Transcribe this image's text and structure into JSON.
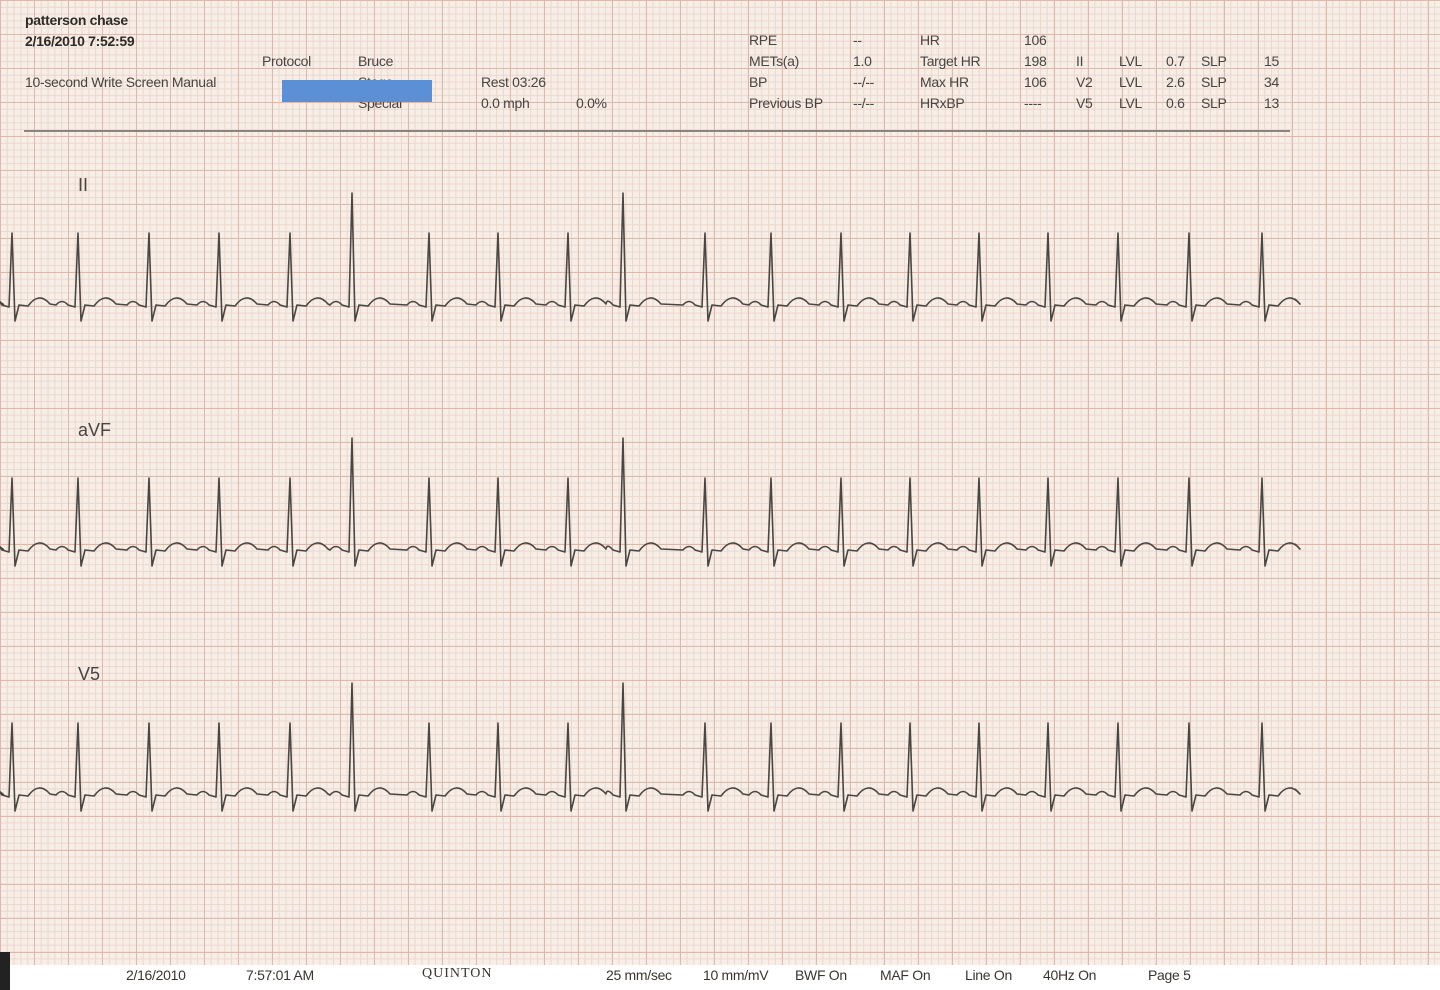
{
  "header": {
    "patient": "patterson chase",
    "datetime": "2/16/2010 7:52:59",
    "mode": "10-second Write Screen Manual",
    "protocol_label": "Protocol",
    "protocol_value": "Bruce",
    "stage_partial": "Stage",
    "stage_partial2": "Special",
    "rest": "Rest 03:26",
    "speed": "0.0 mph",
    "grade": "0.0%"
  },
  "stats": {
    "rpe_label": "RPE",
    "rpe_value": "--",
    "mets_label": "METs(a)",
    "mets_value": "1.0",
    "bp_label": "BP",
    "bp_value": "--/--",
    "prev_bp_label": "Previous BP",
    "prev_bp_value": "--/--",
    "hr_label": "HR",
    "hr_value": "106",
    "target_hr_label": "Target HR",
    "target_hr_value": "198",
    "max_hr_label": "Max HR",
    "max_hr_value": "106",
    "hrxbp_label": "HRxBP",
    "hrxbp_value": "----",
    "st_rows": [
      {
        "lead": "II",
        "lvl_label": "LVL",
        "lvl": "0.7",
        "slp_label": "SLP",
        "slp": "15"
      },
      {
        "lead": "V2",
        "lvl_label": "LVL",
        "lvl": "2.6",
        "slp_label": "SLP",
        "slp": "34"
      },
      {
        "lead": "V5",
        "lvl_label": "LVL",
        "lvl": "0.6",
        "slp_label": "SLP",
        "slp": "13"
      }
    ]
  },
  "leads": [
    "II",
    "aVF",
    "V5"
  ],
  "beats_x": [
    12,
    78,
    149,
    219,
    290,
    352,
    429,
    498,
    568,
    623,
    705,
    771,
    841,
    910,
    979,
    1048,
    1118,
    1189,
    1262
  ],
  "tall_beats": [
    352,
    623
  ],
  "footer": {
    "date": "2/16/2010",
    "time": "7:57:01 AM",
    "logo": "QUINTON",
    "speed": "25 mm/sec",
    "gain": "10 mm/mV",
    "bwf": "BWF  On",
    "maf": "MAF  On",
    "line": "Line On",
    "filter": "40Hz On",
    "page": "Page 5"
  }
}
